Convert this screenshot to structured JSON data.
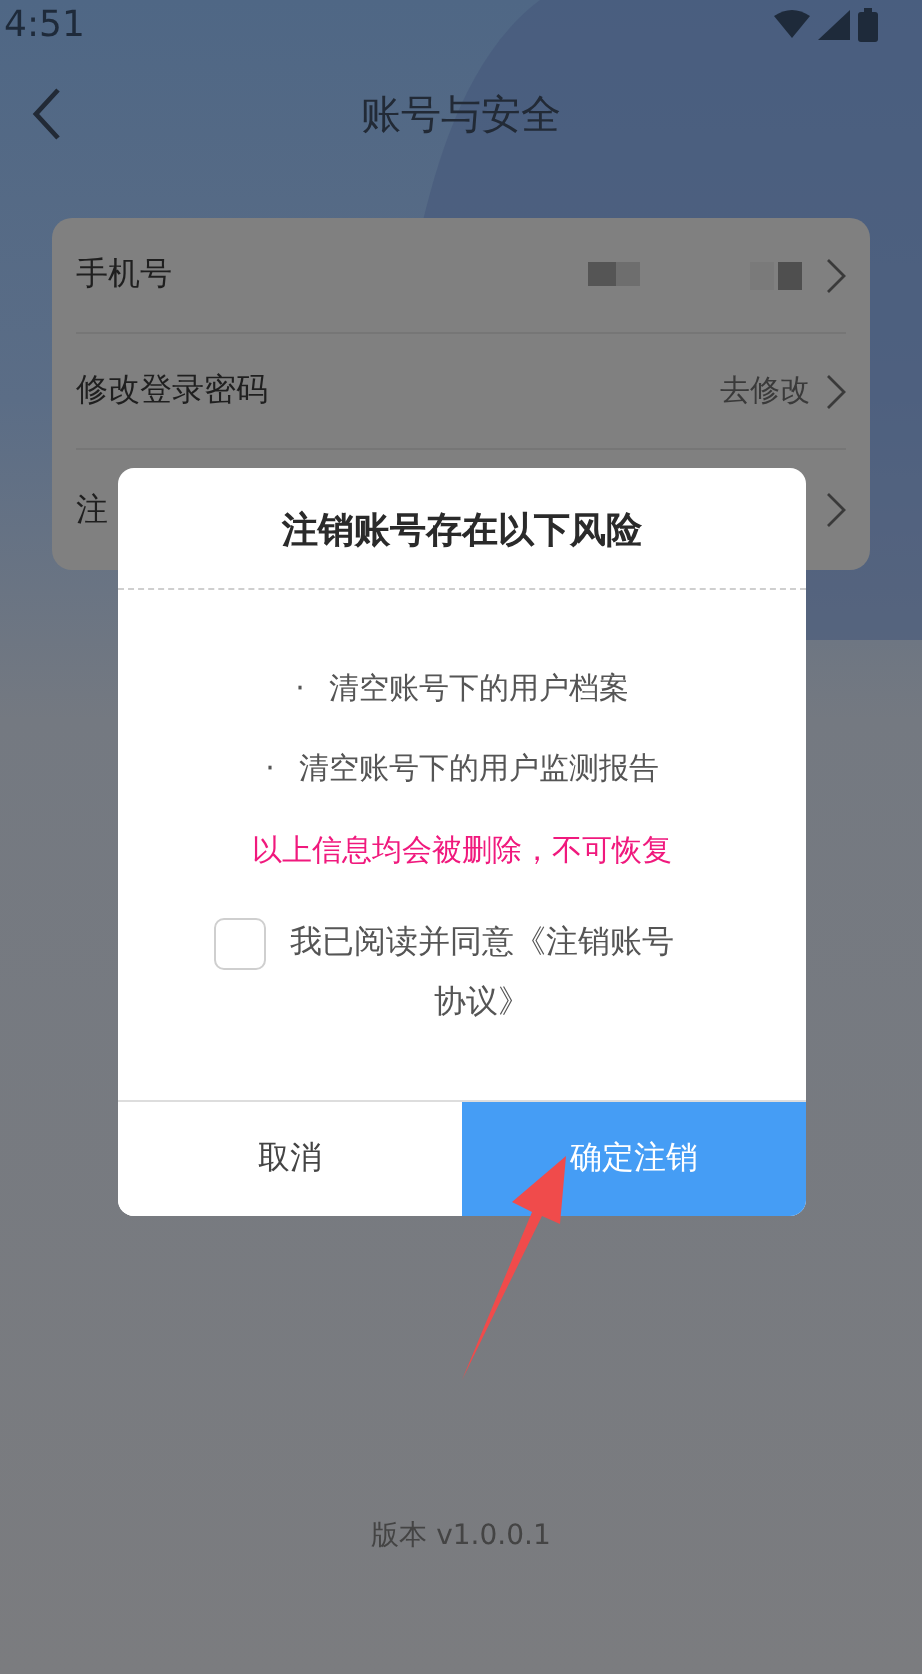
{
  "status_bar": {
    "time": "4:51"
  },
  "header": {
    "title": "账号与安全"
  },
  "settings": [
    {
      "label": "手机号",
      "kind": "redacted"
    },
    {
      "label": "修改登录密码",
      "value": "去修改",
      "kind": "value"
    },
    {
      "label": "注",
      "kind": "covered"
    }
  ],
  "dialog": {
    "title": "注销账号存在以下风险",
    "items": [
      {
        "bullet": "·",
        "text": "清空账号下的用户档案"
      },
      {
        "bullet": "·",
        "text": "清空账号下的用户监测报告"
      }
    ],
    "warning": "以上信息均会被删除，不可恢复",
    "agreement": {
      "checked": false,
      "label": "我已阅读并同意《注销账号协议》"
    },
    "buttons": [
      {
        "label": "取消",
        "kind": "cancel"
      },
      {
        "label": "确定注销",
        "kind": "confirm"
      }
    ]
  },
  "footer": {
    "version": "版本 v1.0.0.1"
  }
}
